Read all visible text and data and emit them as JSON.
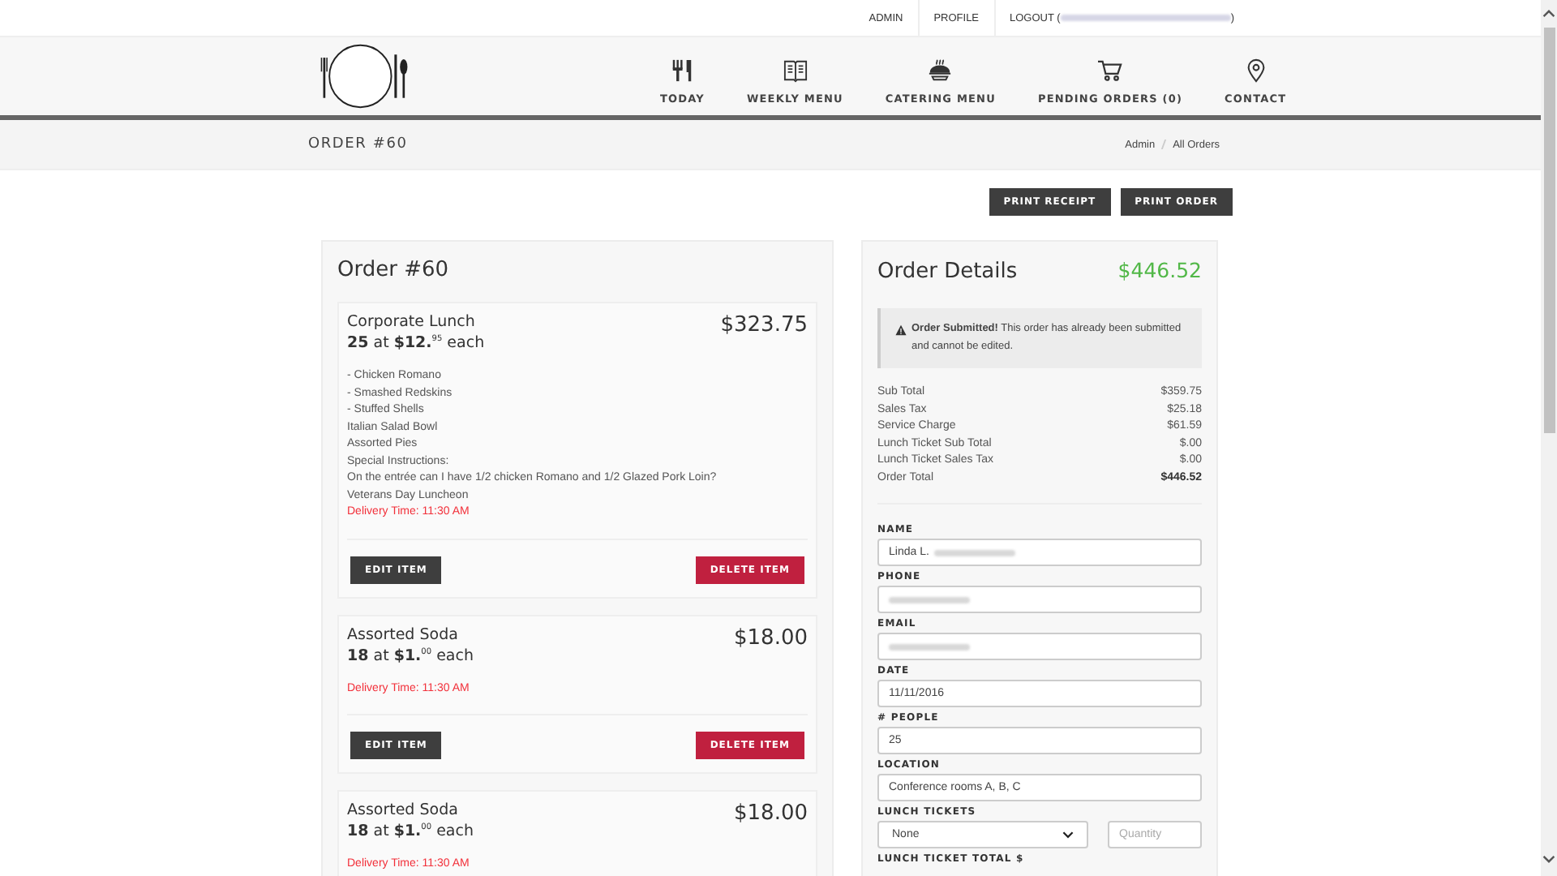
{
  "top_links": [
    {
      "label": "ADMIN"
    },
    {
      "label": "PROFILE"
    },
    {
      "label": "LOGOUT (",
      "suffix": ")",
      "redacted": true
    }
  ],
  "nav": [
    {
      "label": "TODAY",
      "kind": "utensils"
    },
    {
      "label": "WEEKLY MENU",
      "kind": "book"
    },
    {
      "label": "CATERING MENU",
      "kind": "dish"
    },
    {
      "label": "PENDING ORDERS (0)",
      "kind": "cart"
    },
    {
      "label": "CONTACT",
      "kind": "pin"
    }
  ],
  "page_title": "ORDER #60",
  "breadcrumb": [
    "Admin",
    "All Orders"
  ],
  "actions": [
    "PRINT RECEIPT",
    "PRINT ORDER"
  ],
  "order": {
    "title": "Order #60",
    "items": [
      {
        "name": "Corporate Lunch",
        "qty": "**25** at **$12.**$^{95}$ each",
        "price": "$323.75",
        "lines": [
          "- Chicken Romano",
          "- Smashed Redskins",
          "- Stuffed Shells",
          "Italian Salad Bowl",
          "Assorted Pies",
          "Special Instructions:",
          "On the entrée can I have 1/2 chicken Romano and 1/2 Glazed Pork Loin?",
          "Veterans Day Luncheon"
        ],
        "delivery": "Delivery Time: 11:30 AM",
        "buttons": [
          "EDIT ITEM",
          "DELETE ITEM"
        ]
      },
      {
        "name": "Assorted Soda",
        "qty": "**18** at **$1.**$^{00}$ each",
        "price": "$18.00",
        "delivery": "Delivery Time: 11:30 AM",
        "buttons": [
          "EDIT ITEM",
          "DELETE ITEM"
        ]
      },
      {
        "name": "Assorted Soda",
        "qty": "**18** at **$1.**$^{00}$ each",
        "price": "$18.00",
        "delivery": "Delivery Time: 11:30 AM"
      }
    ]
  },
  "details": {
    "title": "Order Details",
    "total": "$446.52",
    "alert": "**Order Submitted!** This order has already been submitted and cannot be edited.",
    "totals": [
      {
        "label": "Sub Total",
        "value": "$359.75",
        "bold": false
      },
      {
        "label": "Sales Tax",
        "value": "$25.18",
        "bold": false
      },
      {
        "label": "Service Charge",
        "value": "$61.59",
        "bold": false
      },
      {
        "label": "Lunch Ticket Sub Total",
        "value": "$.00",
        "bold": false
      },
      {
        "label": "Lunch Ticket Sales Tax",
        "value": "$.00",
        "bold": false
      },
      {
        "label": "Order Total",
        "value": "$446.52",
        "bold": true
      }
    ],
    "fields": [
      {
        "label": "NAME",
        "value": "Linda L.",
        "redacted": true
      },
      {
        "label": "PHONE",
        "redacted": true
      },
      {
        "label": "EMAIL",
        "redacted": true
      },
      {
        "label": "DATE",
        "value": "11/11/2016"
      },
      {
        "label": "# PEOPLE",
        "value": "25"
      },
      {
        "label": "LOCATION",
        "value": "Conference rooms A, B, C"
      }
    ],
    "lunch_tickets": {
      "label": "LUNCH TICKETS",
      "selected": "None",
      "quantity_placeholder": "Quantity"
    },
    "next_label": "LUNCH TICKET TOTAL $"
  }
}
